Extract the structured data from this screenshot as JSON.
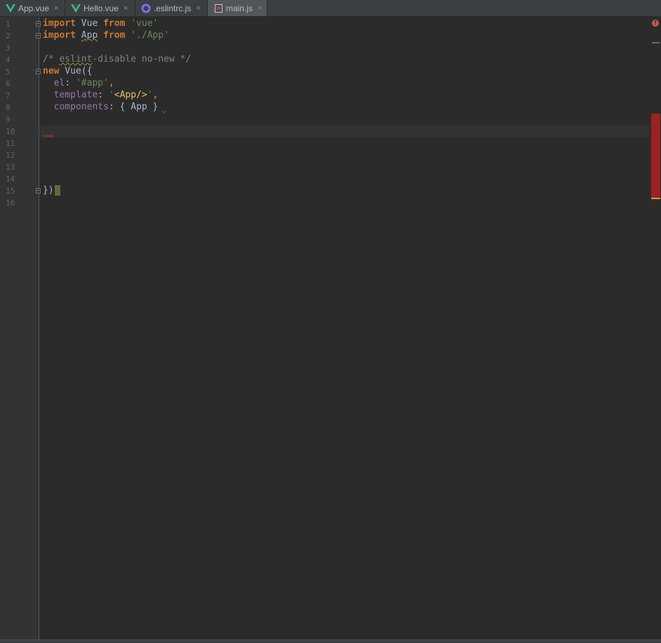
{
  "tabs": [
    {
      "label": "App.vue",
      "icon": "vue-icon",
      "close": "×",
      "active": false
    },
    {
      "label": "Hello.vue",
      "icon": "vue-icon",
      "close": "×",
      "active": false
    },
    {
      "label": ".eslintrc.js",
      "icon": "eslint-icon",
      "close": "×",
      "active": false
    },
    {
      "label": "main.js",
      "icon": "js-file-icon",
      "badge": "JS",
      "close": "×",
      "active": true
    }
  ],
  "editor": {
    "line_numbers": [
      "1",
      "2",
      "3",
      "4",
      "5",
      "6",
      "7",
      "8",
      "9",
      "10",
      "11",
      "12",
      "13",
      "14",
      "15",
      "16"
    ],
    "code": {
      "l1": {
        "kw1": "import",
        "t1": " Vue ",
        "kw2": "from",
        "t2": " ",
        "s1": "'vue'"
      },
      "l2": {
        "kw1": "import",
        "t1": " ",
        "id": "App",
        "t2": " ",
        "kw2": "from",
        "t3": " ",
        "s1": "'./App'"
      },
      "l4": {
        "c1": "/* ",
        "c2": "eslint",
        "c3": "-disable no-new */"
      },
      "l5": {
        "kw1": "new",
        "t1": " Vue({"
      },
      "l6": {
        "p1": "el",
        "t1": ": ",
        "s1": "'#app'",
        "t2": ","
      },
      "l7": {
        "p1": "template",
        "t1": ": ",
        "s1": "'",
        "tag": "<App/>",
        "s2": "'",
        "t2": ","
      },
      "l8": {
        "p1": "components",
        "t1": ": { App }"
      },
      "l15": {
        "t1": "})"
      }
    },
    "error_indicator": "!"
  },
  "colors": {
    "background": "#2b2b2b",
    "gutter": "#313335",
    "keyword": "#cc7832",
    "string": "#6a8759",
    "comment": "#808080",
    "property": "#9876aa",
    "error": "#bc3f3c"
  }
}
